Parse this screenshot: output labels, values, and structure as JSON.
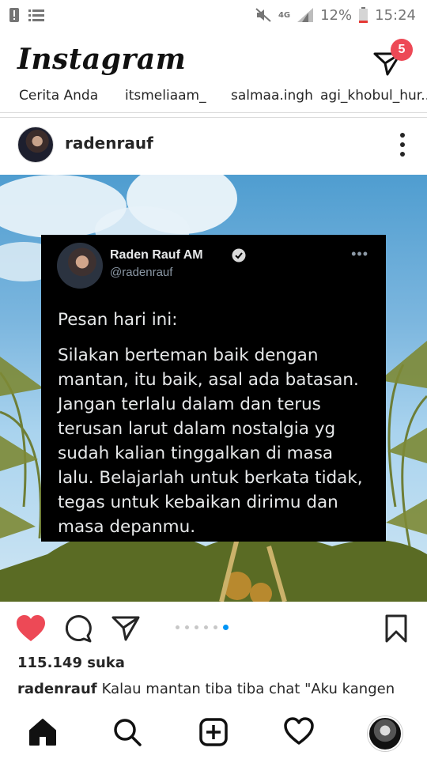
{
  "status_bar": {
    "battery_percent": "12%",
    "time": "15:24",
    "network": "4G"
  },
  "header": {
    "logo": "Instagram",
    "dm_badge_count": "5"
  },
  "stories": [
    "Cerita Anda",
    "itsmeliaam_",
    "salmaa.ingh",
    "agi_khobul_hur..."
  ],
  "post": {
    "username": "radenrauf",
    "tweet": {
      "name": "Raden Rauf AM",
      "handle": "@radenrauf",
      "more": "•••",
      "line1": "Pesan hari ini:",
      "body": "Silakan berteman baik dengan mantan, itu baik, asal ada batasan. Jangan terlalu dalam dan terus terusan larut dalam nostalgia yg sudah kalian tinggalkan di masa lalu. Belajarlah untuk berkata tidak, tegas untuk kebaikan dirimu dan masa depanmu."
    },
    "carousel_total": 6,
    "carousel_active_index": 5,
    "likes": "115.149 suka",
    "caption_user": "radenrauf",
    "caption_text": "Kalau mantan tiba tiba chat \"Aku kangen"
  },
  "colors": {
    "like_active": "#ed4956",
    "carousel_active": "#0095f6",
    "tweet_bg": "#000000"
  },
  "icons": {
    "status_left": [
      "alert-icon",
      "menu-list-icon"
    ],
    "status_right": [
      "mute-icon",
      "network-4g-icon",
      "signal-icon",
      "battery-icon"
    ],
    "actions": [
      "heart-filled-icon",
      "comment-icon",
      "share-icon",
      "bookmark-icon"
    ],
    "nav": [
      "home-icon",
      "search-icon",
      "add-post-icon",
      "activity-heart-icon",
      "profile-avatar-icon"
    ]
  }
}
